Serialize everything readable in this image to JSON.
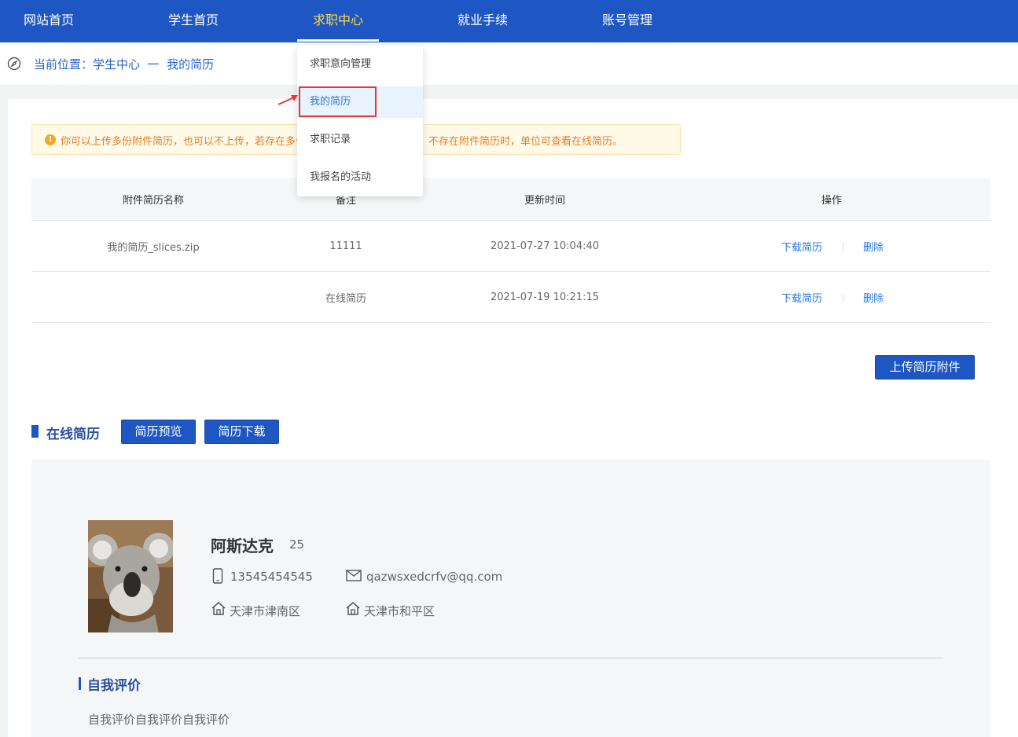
{
  "nav": {
    "items": [
      {
        "label": "网站首页"
      },
      {
        "label": "学生首页"
      },
      {
        "label": "求职中心"
      },
      {
        "label": "就业手续"
      },
      {
        "label": "账号管理"
      }
    ]
  },
  "breadcrumb": {
    "text": "当前位置：学生中心  一  我的简历"
  },
  "dropdown": {
    "items": [
      {
        "label": "求职意向管理"
      },
      {
        "label": "我的简历"
      },
      {
        "label": "求职记录"
      },
      {
        "label": "我报名的活动"
      }
    ]
  },
  "notice": {
    "text": "你可以上传多份附件简历，也可以不上传，若存在多份附件简历，投递时可选择；不存在附件简历时，单位可查看在线简历。"
  },
  "table": {
    "headers": {
      "name": "附件简历名称",
      "remark": "备注",
      "time": "更新时间",
      "action": "操作"
    },
    "rows": [
      {
        "name": "我的简历_slices.zip",
        "remark": "11111",
        "time": "2021-07-27 10:04:40",
        "download": "下载简历",
        "delete": "删除"
      },
      {
        "name": "",
        "remark": "在线简历",
        "time": "2021-07-19 10:21:15",
        "download": "下载简历",
        "delete": "删除"
      }
    ]
  },
  "upload_button": "上传简历附件",
  "online_resume": {
    "title": "在线简历",
    "preview_button": "简历预览",
    "download_button": "简历下载"
  },
  "profile": {
    "name": "阿斯达克",
    "age": "25",
    "phone": "13545454545",
    "email": "qazwsxedcrfv@qq.com",
    "address1": "天津市津南区",
    "address2": "天津市和平区"
  },
  "self_eval": {
    "title": "自我评价",
    "text": "自我评价自我评价自我评价"
  },
  "icons": {
    "breadcrumb": "compass-icon",
    "notice": "warning-icon",
    "phone": "phone-icon",
    "email": "mail-icon",
    "address": "home-icon"
  },
  "colors": {
    "primary": "#1e57c3",
    "active_nav": "#ffd94a",
    "link": "#2a7ae2",
    "highlight": "#e53935"
  }
}
